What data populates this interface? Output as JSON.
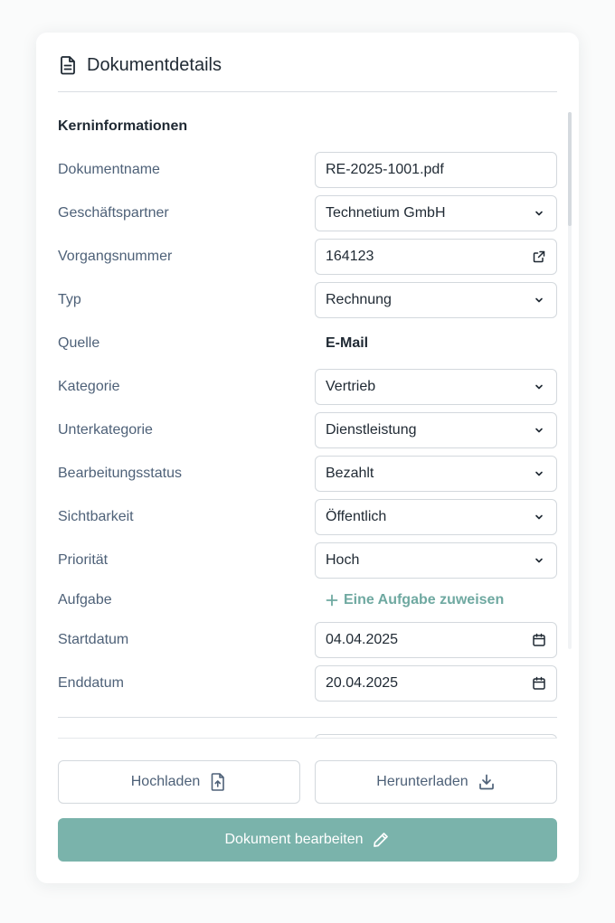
{
  "header": {
    "title": "Dokumentdetails",
    "icon": "document-icon"
  },
  "section": {
    "title": "Kerninformationen"
  },
  "fields": {
    "dokumentname": {
      "label": "Dokumentname",
      "value": "RE-2025-1001.pdf"
    },
    "geschaeftspartner": {
      "label": "Geschäftspartner",
      "value": "Technetium GmbH",
      "icon": "chevron-down-icon"
    },
    "vorgangsnummer": {
      "label": "Vorgangsnummer",
      "value": "164123",
      "icon": "external-link-icon"
    },
    "typ": {
      "label": "Typ",
      "value": "Rechnung",
      "icon": "chevron-down-icon"
    },
    "quelle": {
      "label": "Quelle",
      "value": "E-Mail"
    },
    "kategorie": {
      "label": "Kategorie",
      "value": "Vertrieb",
      "icon": "chevron-down-icon"
    },
    "unterkategorie": {
      "label": "Unterkategorie",
      "value": "Dienstleistung",
      "icon": "chevron-down-icon"
    },
    "bearbeitungsstatus": {
      "label": "Bearbeitungsstatus",
      "value": "Bezahlt",
      "icon": "chevron-down-icon"
    },
    "sichtbarkeit": {
      "label": "Sichtbarkeit",
      "value": "Öffentlich",
      "icon": "chevron-down-icon"
    },
    "prioritaet": {
      "label": "Priorität",
      "value": "Hoch",
      "icon": "chevron-down-icon"
    },
    "aufgabe": {
      "label": "Aufgabe",
      "link": "Eine Aufgabe zuweisen",
      "icon": "plus-icon"
    },
    "startdatum": {
      "label": "Startdatum",
      "value": "04.04.2025",
      "icon": "calendar-icon"
    },
    "enddatum": {
      "label": "Enddatum",
      "value": "20.04.2025",
      "icon": "calendar-icon"
    }
  },
  "buttons": {
    "upload": {
      "label": "Hochladen",
      "icon": "upload-file-icon"
    },
    "download": {
      "label": "Herunterladen",
      "icon": "download-icon"
    },
    "edit": {
      "label": "Dokument bearbeiten",
      "icon": "pencil-icon"
    }
  },
  "colors": {
    "accent": "#7ab3ab",
    "link": "#6fa9a1",
    "label": "#4e6178",
    "text": "#1f2933",
    "border": "#d3d8dd"
  }
}
